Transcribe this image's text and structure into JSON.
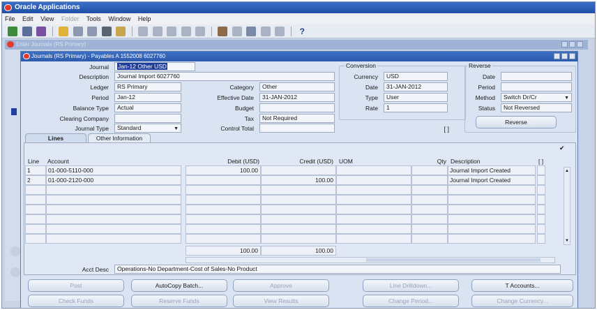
{
  "app": {
    "title": "Oracle Applications",
    "menu": [
      {
        "label": "File",
        "enabled": true
      },
      {
        "label": "Edit",
        "enabled": true
      },
      {
        "label": "View",
        "enabled": true
      },
      {
        "label": "Folder",
        "enabled": false
      },
      {
        "label": "Tools",
        "enabled": true
      },
      {
        "label": "Window",
        "enabled": true
      },
      {
        "label": "Help",
        "enabled": true
      }
    ],
    "toolbar_help": "?"
  },
  "background_window": {
    "title": "Enter Journals (RS Primary)"
  },
  "window": {
    "title": "Journals (RS Primary) - Payables A 1552008 6027760"
  },
  "header": {
    "journal_label": "Journal",
    "journal_value": "Jan-12 Other USD",
    "description_label": "Description",
    "description_value": "Journal Import 6027760",
    "ledger_label": "Ledger",
    "ledger_value": "RS Primary",
    "period_label": "Period",
    "period_value": "Jan-12",
    "balance_type_label": "Balance Type",
    "balance_type_value": "Actual",
    "clearing_company_label": "Clearing Company",
    "clearing_company_value": "",
    "journal_type_label": "Journal Type",
    "journal_type_value": "Standard",
    "category_label": "Category",
    "category_value": "Other",
    "effective_date_label": "Effective Date",
    "effective_date_value": "31-JAN-2012",
    "budget_label": "Budget",
    "budget_value": "",
    "tax_label": "Tax",
    "tax_value": "Not Required",
    "control_total_label": "Control Total",
    "control_total_value": "",
    "flex_indicator": "[ ]"
  },
  "conversion": {
    "title": "Conversion",
    "currency_label": "Currency",
    "currency_value": "USD",
    "date_label": "Date",
    "date_value": "31-JAN-2012",
    "type_label": "Type",
    "type_value": "User",
    "rate_label": "Rate",
    "rate_value": "1"
  },
  "reverse": {
    "title": "Reverse",
    "date_label": "Date",
    "date_value": "",
    "period_label": "Period",
    "period_value": "",
    "method_label": "Method",
    "method_value": "Switch Dr/Cr",
    "status_label": "Status",
    "status_value": "Not Reversed",
    "button_label": "Reverse"
  },
  "tabs": [
    {
      "label": "Lines",
      "active": true
    },
    {
      "label": "Other Information",
      "active": false
    }
  ],
  "lines": {
    "columns": {
      "line": "Line",
      "account": "Account",
      "debit": "Debit (USD)",
      "credit": "Credit (USD)",
      "uom": "UOM",
      "qty": "Qty",
      "description": "Description",
      "flex": "[ ]"
    },
    "rows": [
      {
        "line": "1",
        "account": "01-000-5110-000",
        "debit": "100.00",
        "credit": "",
        "uom": "",
        "qty": "",
        "description": "Journal Import Created"
      },
      {
        "line": "2",
        "account": "01-000-2120-000",
        "debit": "",
        "credit": "100.00",
        "uom": "",
        "qty": "",
        "description": "Journal Import Created"
      },
      {
        "line": "",
        "account": "",
        "debit": "",
        "credit": "",
        "uom": "",
        "qty": "",
        "description": ""
      },
      {
        "line": "",
        "account": "",
        "debit": "",
        "credit": "",
        "uom": "",
        "qty": "",
        "description": ""
      },
      {
        "line": "",
        "account": "",
        "debit": "",
        "credit": "",
        "uom": "",
        "qty": "",
        "description": ""
      },
      {
        "line": "",
        "account": "",
        "debit": "",
        "credit": "",
        "uom": "",
        "qty": "",
        "description": ""
      },
      {
        "line": "",
        "account": "",
        "debit": "",
        "credit": "",
        "uom": "",
        "qty": "",
        "description": ""
      },
      {
        "line": "",
        "account": "",
        "debit": "",
        "credit": "",
        "uom": "",
        "qty": "",
        "description": ""
      }
    ],
    "total_debit": "100.00",
    "total_credit": "100.00"
  },
  "acct_desc": {
    "label": "Acct Desc",
    "value": "Operations-No Department-Cost of Sales-No Product"
  },
  "buttons": {
    "row1": [
      {
        "label": "Post",
        "enabled": false
      },
      {
        "label": "AutoCopy Batch...",
        "enabled": true
      },
      {
        "label": "Approve",
        "enabled": false
      },
      {
        "label": "Line Drilldown...",
        "enabled": false
      },
      {
        "label": "T Accounts...",
        "enabled": true
      }
    ],
    "row2": [
      {
        "label": "Check Funds",
        "enabled": false
      },
      {
        "label": "Reserve Funds",
        "enabled": false
      },
      {
        "label": "View Results",
        "enabled": false
      },
      {
        "label": "Change Period...",
        "enabled": false
      },
      {
        "label": "Change Currency...",
        "enabled": false
      }
    ]
  }
}
